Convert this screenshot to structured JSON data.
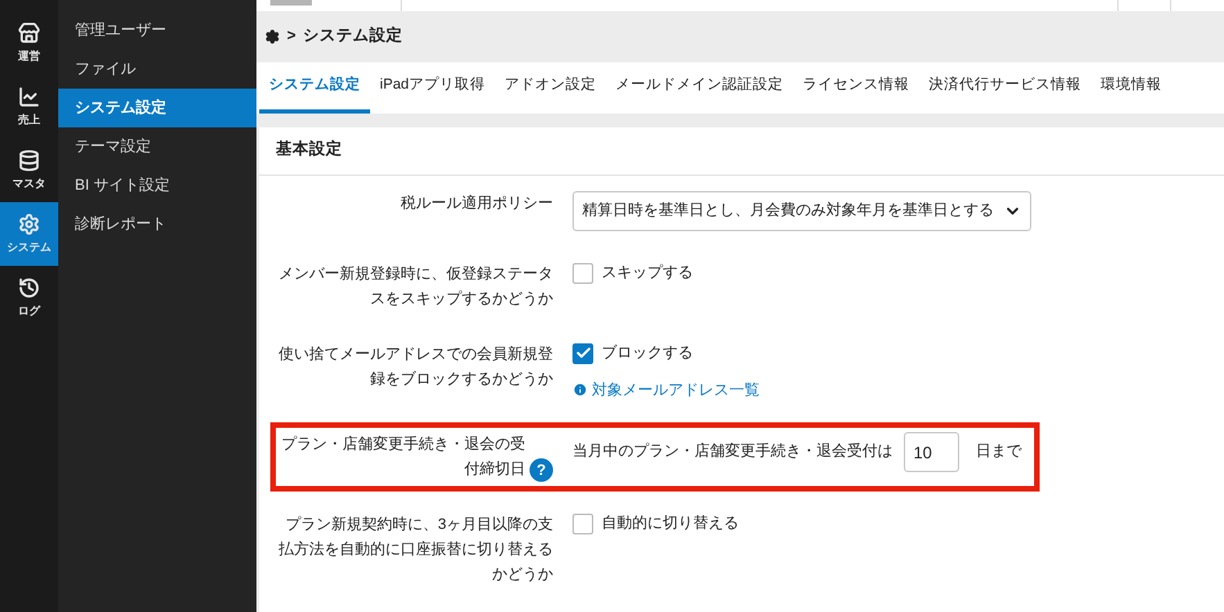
{
  "rail": [
    {
      "label": "運営",
      "selected": false
    },
    {
      "label": "売上",
      "selected": false
    },
    {
      "label": "マスタ",
      "selected": false
    },
    {
      "label": "システム",
      "selected": true
    },
    {
      "label": "ログ",
      "selected": false
    }
  ],
  "submenu": [
    {
      "label": "管理ユーザー",
      "selected": false
    },
    {
      "label": "ファイル",
      "selected": false
    },
    {
      "label": "システム設定",
      "selected": true
    },
    {
      "label": "テーマ設定",
      "selected": false
    },
    {
      "label": "BI サイト設定",
      "selected": false
    },
    {
      "label": "診断レポート",
      "selected": false
    }
  ],
  "breadcrumb": {
    "separator": ">",
    "current": "システム設定"
  },
  "tabs": [
    {
      "label": "システム設定",
      "selected": true
    },
    {
      "label": "iPadアプリ取得",
      "selected": false
    },
    {
      "label": "アドオン設定",
      "selected": false
    },
    {
      "label": "メールドメイン認証設定",
      "selected": false
    },
    {
      "label": "ライセンス情報",
      "selected": false
    },
    {
      "label": "決済代行サービス情報",
      "selected": false
    },
    {
      "label": "環境情報",
      "selected": false
    }
  ],
  "section": {
    "title": "基本設定",
    "rows": [
      {
        "kind": "select",
        "label": "税ルール適用ポリシー",
        "value": "精算日時を基準日とし、月会費のみ対象年月を基準日とする",
        "highlighted": false
      },
      {
        "kind": "checkbox",
        "label": "メンバー新規登録時に、仮登録ステータスをスキップするかどうか",
        "option": "スキップする",
        "checked": false,
        "highlighted": false
      },
      {
        "kind": "checkbox",
        "label": "使い捨てメールアドレスでの会員新規登録をブロックするかどうか",
        "option": "ブロックする",
        "checked": true,
        "link": "対象メールアドレス一覧",
        "highlighted": false
      },
      {
        "kind": "number",
        "label": "プラン・店舗変更手続き・退会の受付締切日",
        "help": "?",
        "prefix": "当月中のプラン・店舗変更手続き・退会受付は",
        "value": "10",
        "suffix": "日まで",
        "highlighted": true
      },
      {
        "kind": "checkbox",
        "label": "プラン新規契約時に、3ヶ月目以降の支払方法を自動的に口座振替に切り替えるかどうか",
        "option": "自動的に切り替える",
        "checked": false,
        "highlighted": false
      }
    ]
  }
}
